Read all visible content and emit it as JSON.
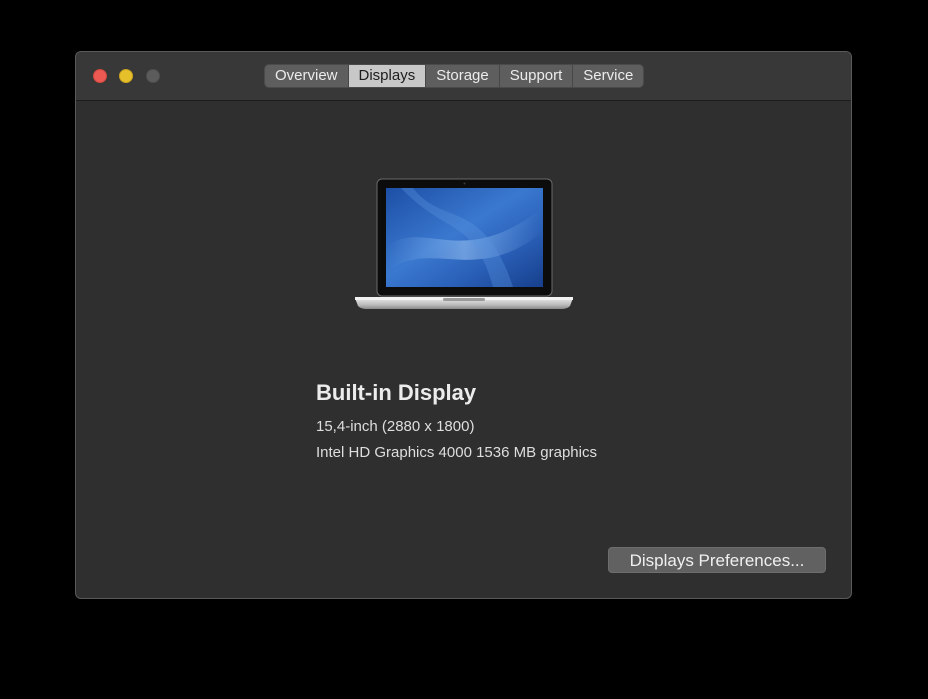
{
  "window": {
    "tabs": [
      {
        "label": "Overview",
        "active": false
      },
      {
        "label": "Displays",
        "active": true
      },
      {
        "label": "Storage",
        "active": false
      },
      {
        "label": "Support",
        "active": false
      },
      {
        "label": "Service",
        "active": false
      }
    ]
  },
  "display": {
    "name": "Built-in Display",
    "size": "15,4-inch (2880 x 1800)",
    "graphics": "Intel HD Graphics 4000 1536 MB graphics",
    "image_icon": "macbook-pro-laptop-icon"
  },
  "buttons": {
    "preferences_label": "Displays Preferences..."
  },
  "colors": {
    "close": "#ee5a52",
    "minimize": "#e5c02b",
    "zoom": "#5c5c5c",
    "window_bg": "#2f2f2f",
    "tab_active": "#c8c8c8"
  }
}
